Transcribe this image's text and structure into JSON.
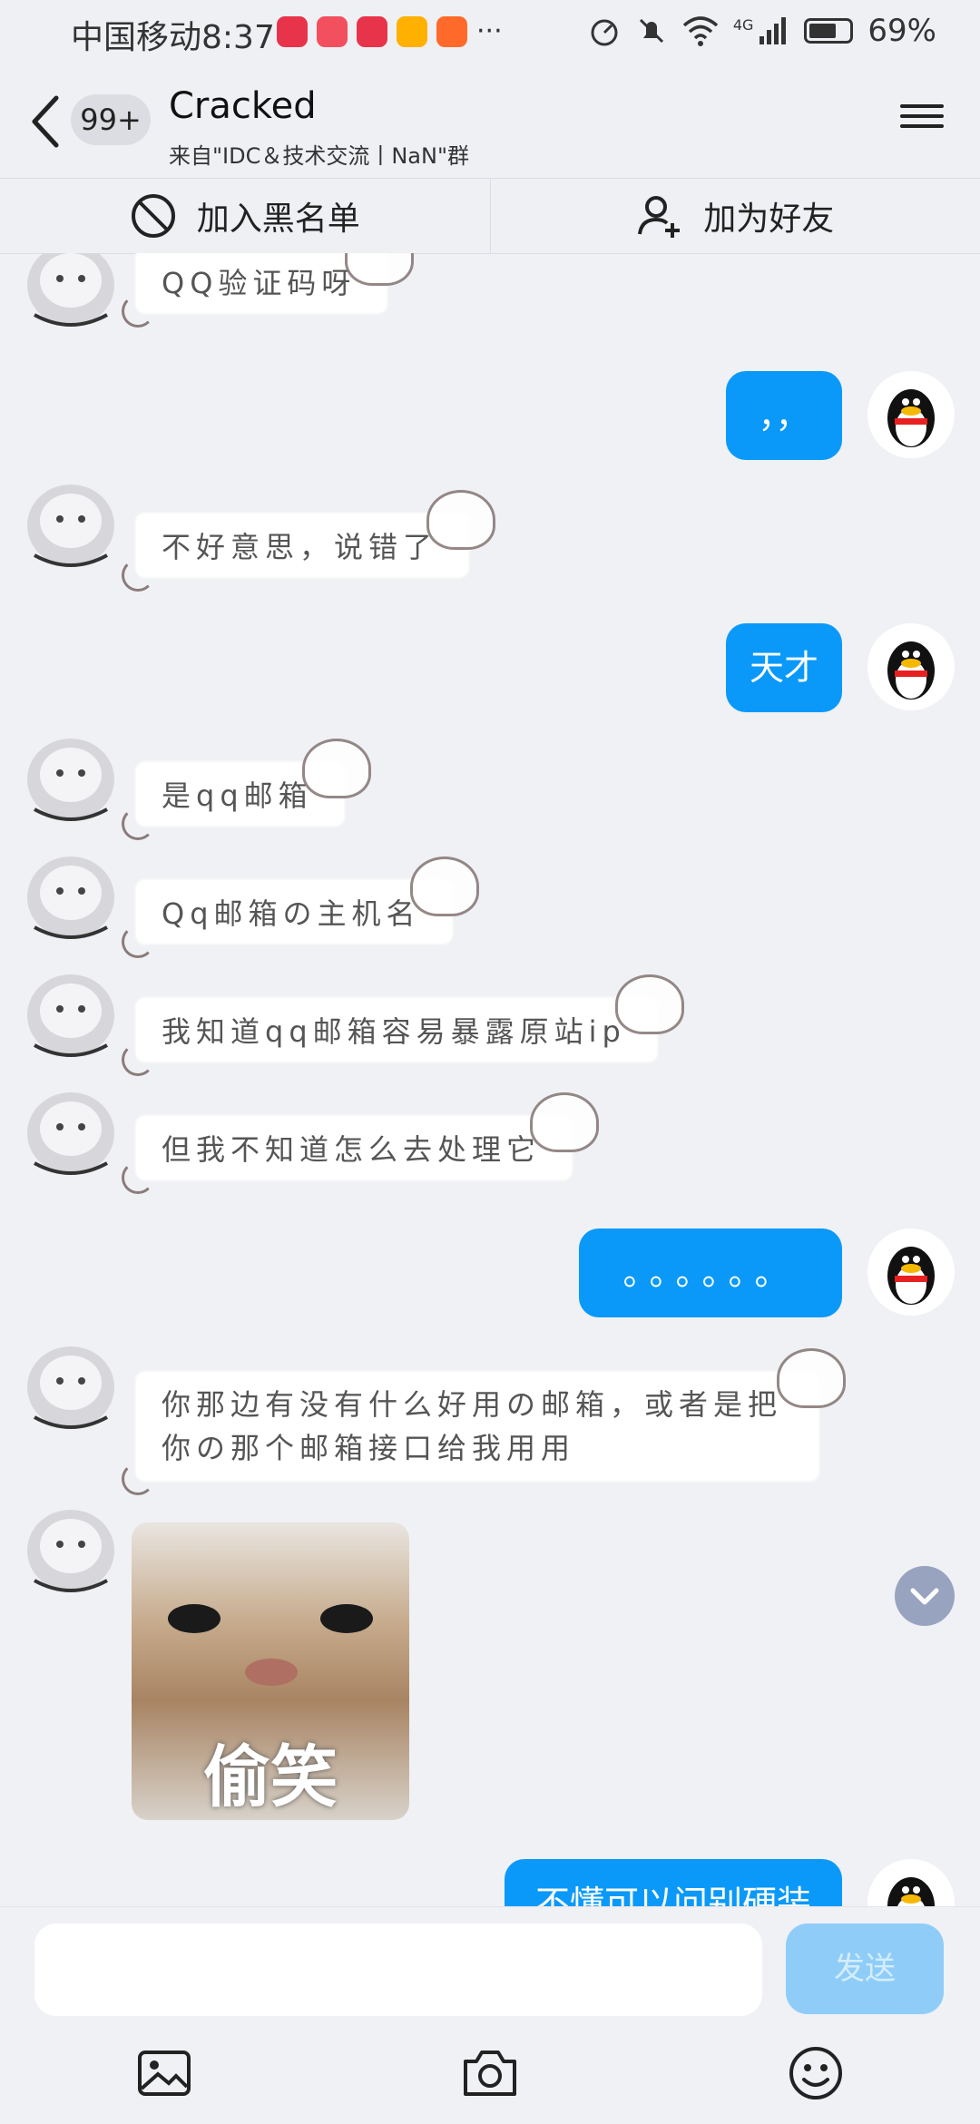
{
  "status_bar": {
    "carrier": "中国移动",
    "time": "8:37",
    "more": "···",
    "network": "4G",
    "battery": "69%",
    "battery_level": 0.69
  },
  "header": {
    "unread_badge": "99+",
    "title": "Cracked",
    "subtitle": "来自\"IDC＆技术交流丨NaN\"群"
  },
  "actions": {
    "block_label": "加入黑名单",
    "add_friend_label": "加为好友"
  },
  "messages": [
    {
      "side": "left",
      "type": "sticker_text",
      "text": "QQ验证码呀"
    },
    {
      "side": "right",
      "type": "text",
      "text": "，，"
    },
    {
      "side": "left",
      "type": "sticker_text",
      "text": "不好意思，说错了"
    },
    {
      "side": "right",
      "type": "text",
      "text": "天才"
    },
    {
      "side": "left",
      "type": "sticker_text",
      "text": "是qq邮箱"
    },
    {
      "side": "left",
      "type": "sticker_text",
      "text": "Qq邮箱の主机名"
    },
    {
      "side": "left",
      "type": "sticker_text",
      "text": "我知道qq邮箱容易暴露原站ip"
    },
    {
      "side": "left",
      "type": "sticker_text",
      "text": "但我不知道怎么去处理它"
    },
    {
      "side": "right",
      "type": "text",
      "text": "。。。。。。"
    },
    {
      "side": "left",
      "type": "sticker_text",
      "text": "你那边有没有什么好用の邮箱，或者是把你の那个邮箱接口给我用用"
    },
    {
      "side": "left",
      "type": "image",
      "caption": "偷笑"
    },
    {
      "side": "right",
      "type": "text",
      "text": "不懂可以问别硬装"
    }
  ],
  "input": {
    "placeholder": "",
    "send_label": "发送"
  },
  "icons": {
    "back": "chevron-left-icon",
    "menu": "hamburger-menu-icon",
    "block": "ban-icon",
    "add_friend": "add-user-icon",
    "scroll_down": "chevron-down-icon",
    "image": "image-icon",
    "camera": "camera-icon",
    "emoji": "emoji-icon"
  },
  "colors": {
    "accent": "#0a99f8",
    "send_disabled": "#8fcdf8",
    "background": "#f0f1f5"
  }
}
